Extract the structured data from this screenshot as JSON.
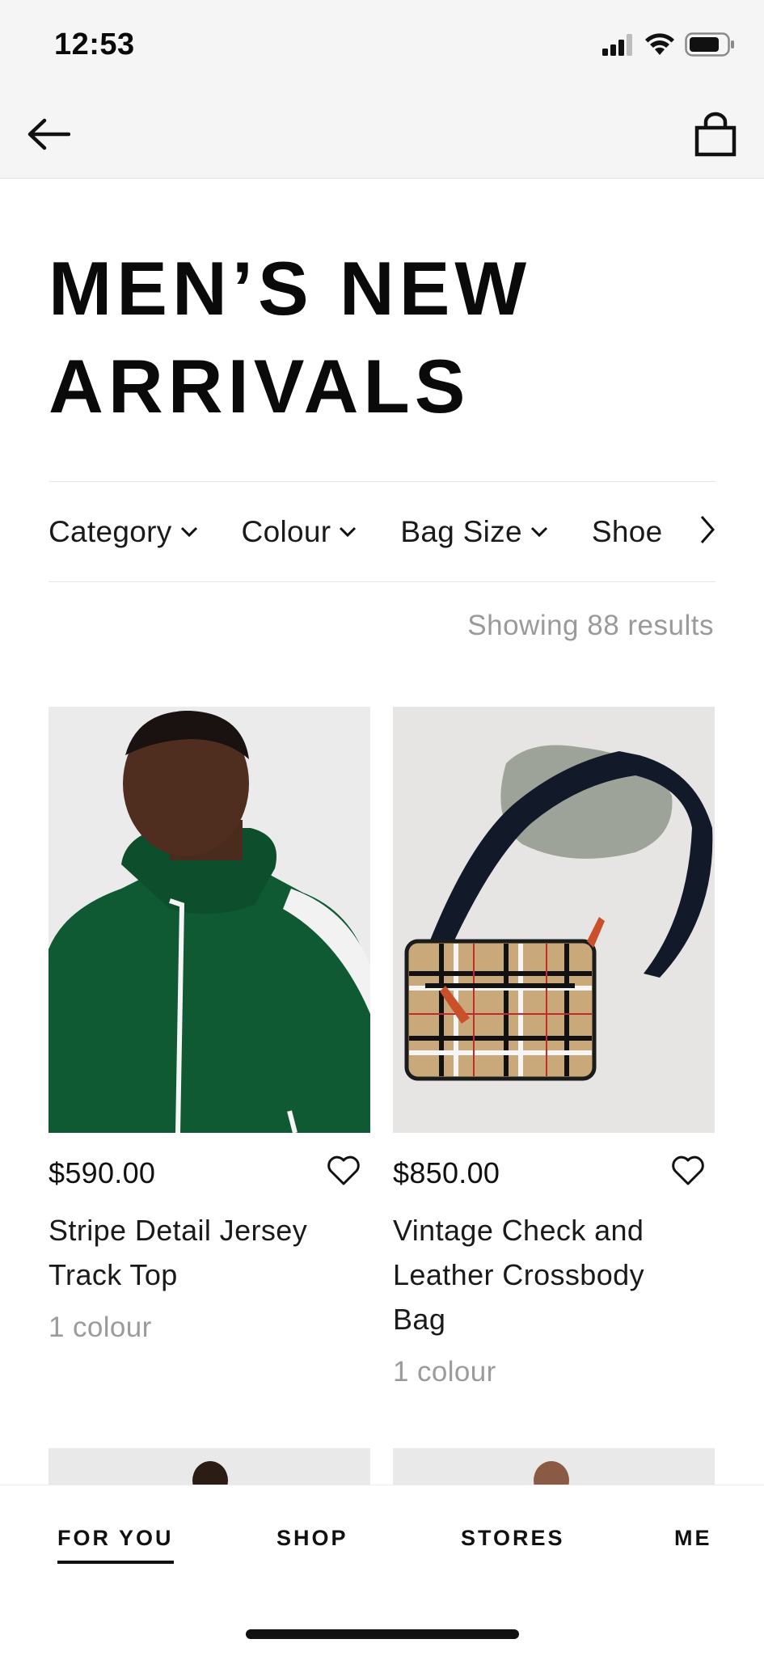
{
  "status_bar": {
    "time": "12:53",
    "icons": [
      "cellular-signal-icon",
      "wifi-icon",
      "battery-icon"
    ]
  },
  "nav": {
    "back_icon": "arrow-left-icon",
    "bag_icon": "shopping-bag-icon"
  },
  "page": {
    "title": "MEN’S NEW ARRIVALS"
  },
  "filters": {
    "items": [
      {
        "label": "Category"
      },
      {
        "label": "Colour"
      },
      {
        "label": "Bag Size"
      },
      {
        "label": "Shoe"
      }
    ],
    "more_icon": "chevron-right-icon"
  },
  "results": {
    "text": "Showing 88 results"
  },
  "products": [
    {
      "price": "$590.00",
      "name": "Stripe Detail Jersey Track Top",
      "colours": "1 colour",
      "fav_icon": "heart-outline-icon"
    },
    {
      "price": "$850.00",
      "name": "Vintage Check and Leather Crossbody Bag",
      "colours": "1 colour",
      "fav_icon": "heart-outline-icon"
    }
  ],
  "tabbar": {
    "tabs": [
      {
        "label": "FOR YOU",
        "active": true
      },
      {
        "label": "SHOP",
        "active": false
      },
      {
        "label": "STORES",
        "active": false
      },
      {
        "label": "ME",
        "active": false
      }
    ]
  },
  "colors": {
    "background": "#ffffff",
    "header_bg": "#f5f5f5",
    "text": "#111111",
    "muted_text": "#9a9a9a",
    "jacket_green": "#0f5a33"
  }
}
